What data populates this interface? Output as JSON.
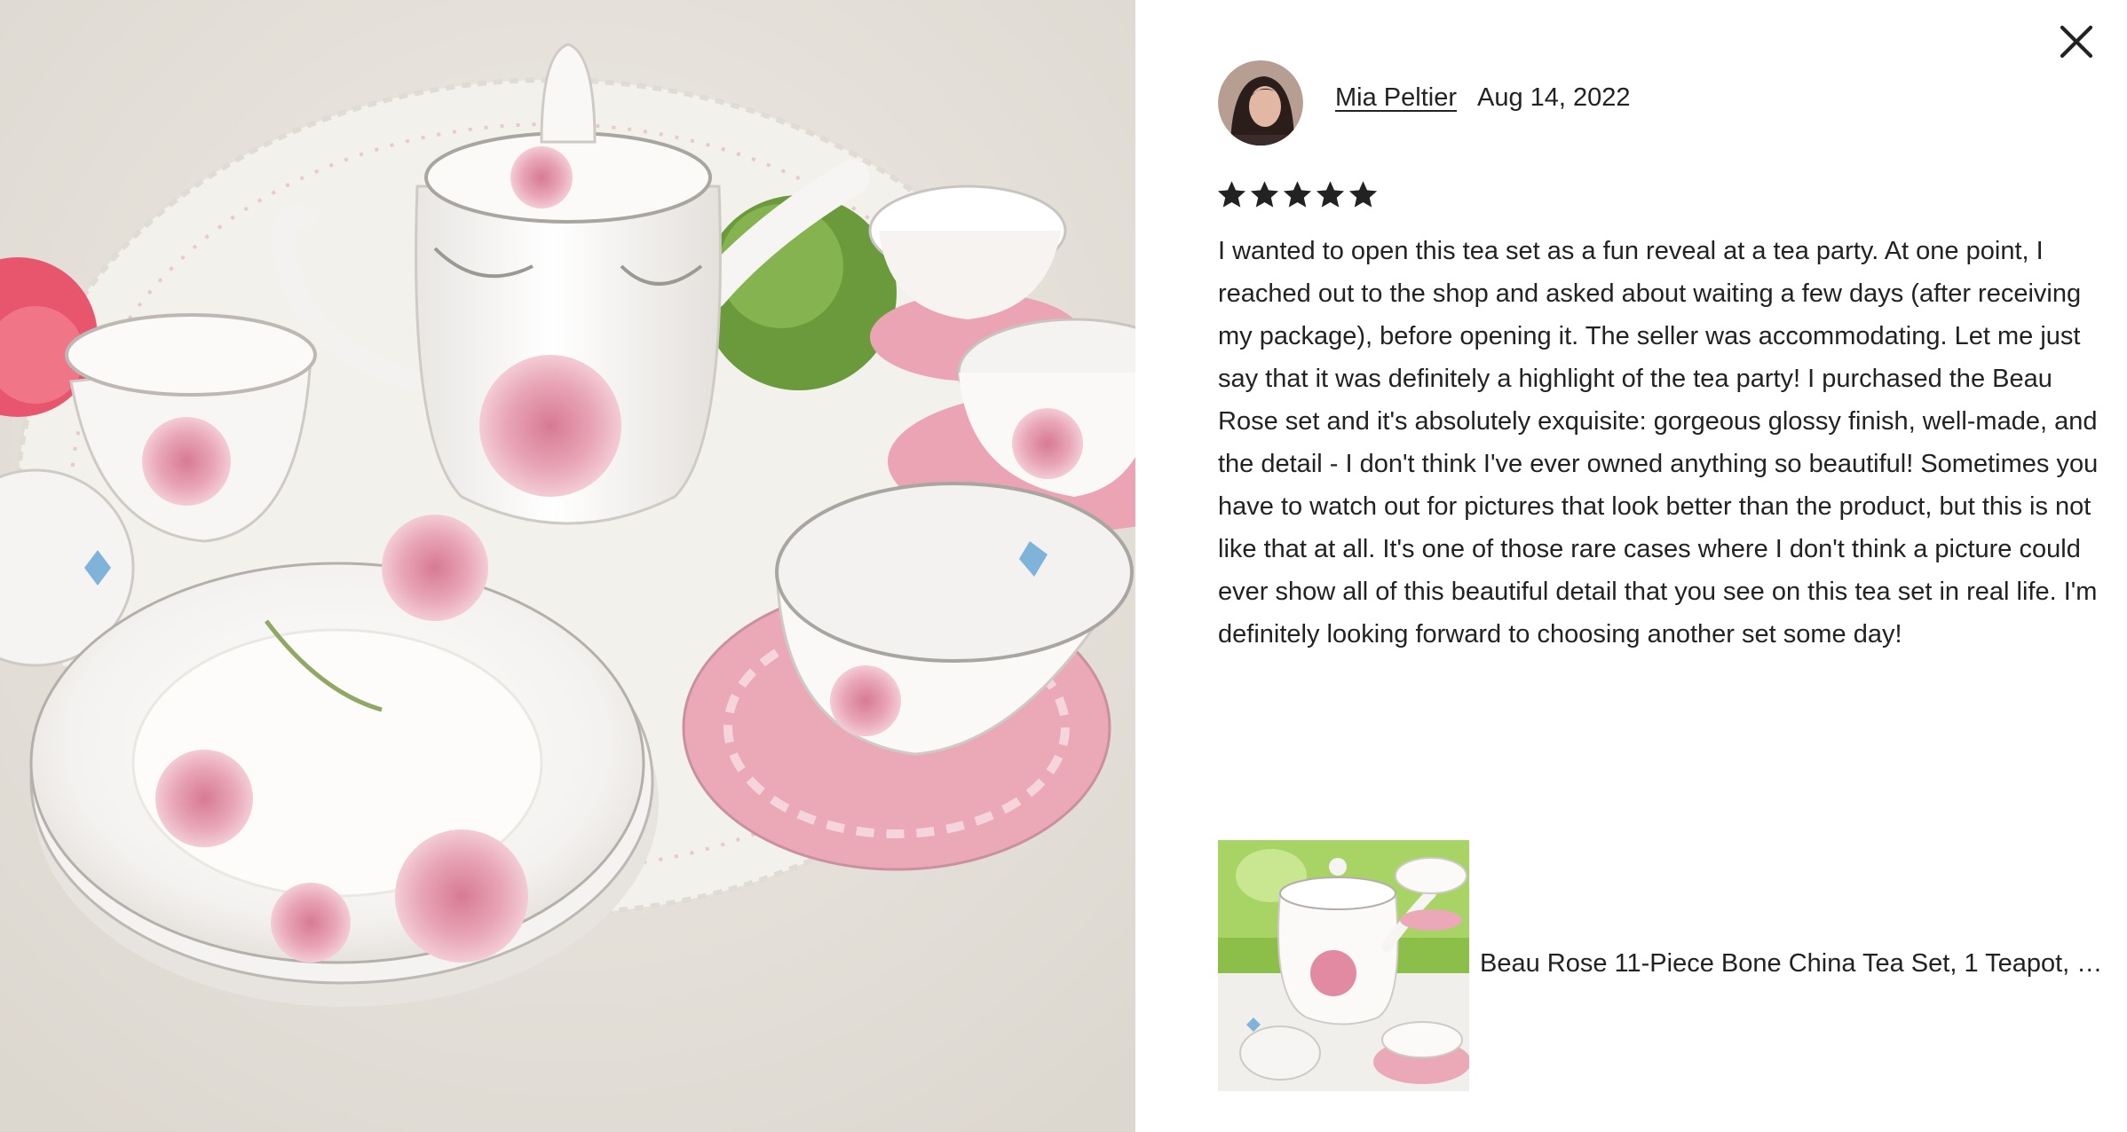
{
  "photo": {
    "icon": "tea-set-photo"
  },
  "close": {
    "icon": "close-icon"
  },
  "review": {
    "reviewer_name": "Mia Peltier",
    "date": "Aug 14, 2022",
    "rating": 5,
    "rating_max": 5,
    "text": "I wanted to open this tea set as a fun reveal at a tea party. At one point, I reached out to the shop and asked about waiting a few days (after receiving my package), before opening it. The seller was accommodating. Let me just say that it was definitely a highlight of the tea party! I purchased the Beau Rose set and it's absolutely exquisite: gorgeous glossy finish, well-made, and the detail - I don't think I've ever owned anything so beautiful! Sometimes you have to watch out for pictures that look better than the product, but this is not like that at all. It's one of those rare cases where I don't think a picture could ever show all of this beautiful detail that you see on this tea set in real life. I'm definitely looking forward to choosing another set some day!"
  },
  "listing": {
    "title": "Beau Rose 11-Piece Bone China Tea Set, 1 Teapot, 1 ..."
  },
  "colors": {
    "text": "#222222",
    "star": "#222222",
    "rose_pink": "#e7a3b5",
    "saucer_pink": "#ecacb8",
    "tablecloth": "#e9e5df"
  }
}
